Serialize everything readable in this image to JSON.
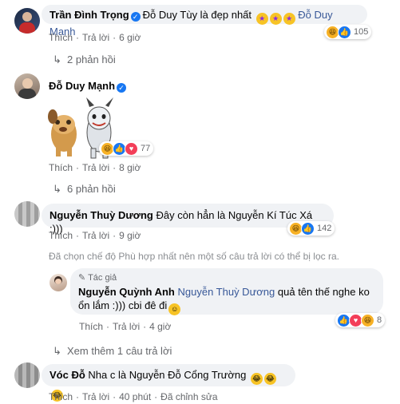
{
  "comments": [
    {
      "name": "Trần Đình Trọng",
      "text": "Đỗ Duy Tùy là đẹp nhất",
      "mention": "Đỗ Duy Mạnh",
      "reactions": "105",
      "like": "Thích",
      "reply": "Trả lời",
      "time": "6 giờ",
      "replies_label": "2 phản hồi"
    },
    {
      "name": "Đỗ Duy Mạnh",
      "reactions": "77",
      "like": "Thích",
      "reply": "Trả lời",
      "time": "8 giờ",
      "replies_label": "6 phản hồi"
    },
    {
      "name": "Nguyễn Thuỳ Dương",
      "text": "Đây còn hẳn là Nguyễn Kí Túc Xá :)))",
      "reactions": "142",
      "like": "Thích",
      "reply": "Trả lời",
      "time": "9 giờ",
      "filter_note": "Đã chọn chế độ Phù hợp nhất nên một số câu trả lời có thể bị lọc ra."
    },
    {
      "author_tag": "Tác giả",
      "name": "Nguyễn Quỳnh Anh",
      "mention": "Nguyễn Thuỳ Dương",
      "text_line1": "quả tên thế nghe ko",
      "text_line2": "ổn lắm :))) cbi đê đi",
      "reactions": "8",
      "like": "Thích",
      "reply": "Trả lời",
      "time": "4 giờ",
      "more_replies": "Xem thêm 1 câu trả lời"
    },
    {
      "name": "Vóc Đỗ",
      "text": "Nha c là Nguyễn Đỗ Cổng Trường",
      "like": "Thích",
      "reply": "Trả lời",
      "time": "40 phút",
      "edited": "Đã chỉnh sửa"
    }
  ],
  "icons": {
    "verified": "verified-badge-icon",
    "star_struck": "star-struck-emoji-icon",
    "rofl": "rofl-emoji-icon",
    "smile": "smile-emoji-icon",
    "reply_arrow": "reply-arrow-icon"
  },
  "colors": {
    "bubble": "#f0f2f5",
    "link": "#385898",
    "secondary_text": "#65676b",
    "like_blue": "#1877f2",
    "haha_yellow": "#f7b125",
    "love_red": "#f33e58"
  }
}
